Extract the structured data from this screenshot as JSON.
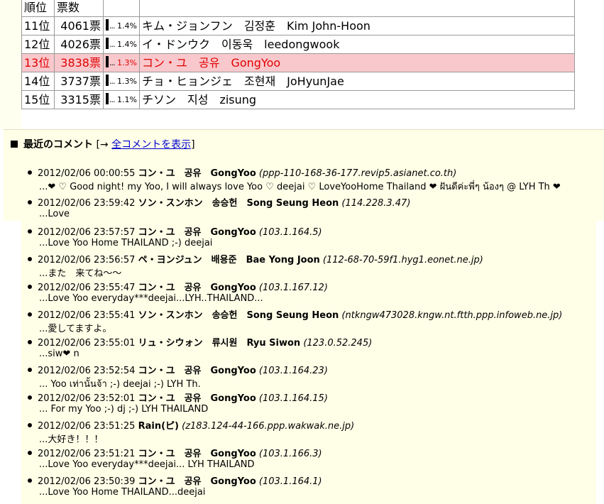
{
  "ranking": {
    "header": {
      "rank": "順位",
      "votes": "票数"
    },
    "rows": [
      {
        "rank": "11位",
        "votes": "4061票",
        "pct": "1.4%",
        "name": "キム・ジョンフン　김정훈　Kim John-Hoon",
        "highlight": false
      },
      {
        "rank": "12位",
        "votes": "4026票",
        "pct": "1.4%",
        "name": "イ・ドンウク　이동욱　leedongwook",
        "highlight": false
      },
      {
        "rank": "13位",
        "votes": "3838票",
        "pct": "1.3%",
        "name": "コン・ユ　공유　GongYoo",
        "highlight": true
      },
      {
        "rank": "14位",
        "votes": "3737票",
        "pct": "1.3%",
        "name": "チョ・ヒョンジェ　조현재　JoHyunJae",
        "highlight": false
      },
      {
        "rank": "15位",
        "votes": "3315票",
        "pct": "1.1%",
        "name": "チソン　지성　zisung",
        "highlight": false
      }
    ]
  },
  "comments": {
    "title": "最近のコメント",
    "link_prefix": " [→ ",
    "link_label": "全コメントを表示",
    "link_suffix": "]",
    "items": [
      {
        "time": "2012/02/06 00:00:55",
        "name": "コン・ユ　공유　GongYoo",
        "host": "(ppp-110-168-36-177.revip5.asianet.co.th)",
        "text": "...❤ ♡ Good night! my Yoo, I will always love Yoo ♡ deejai ♡ LoveYooHome Thailand ❤ ฝันดีค่ะพี่ๆ น้องๆ @ LYH Th ❤"
      },
      {
        "time": "2012/02/06 23:59:42",
        "name": "ソン・スンホン　송승헌　Song Seung Heon",
        "host": "(114.228.3.47)",
        "text": "...Love"
      },
      {
        "time": "2012/02/06 23:57:57",
        "name": "コン・ユ　공유　GongYoo",
        "host": "(103.1.164.5)",
        "text": "...Love Yoo Home THAILAND ;-) deejai"
      },
      {
        "time": "2012/02/06 23:56:57",
        "name": "ペ・ヨンジュン　배용준　Bae Yong Joon",
        "host": "(112-68-70-59f1.hyg1.eonet.ne.jp)",
        "text": "...また　来てね～～"
      },
      {
        "time": "2012/02/06 23:55:47",
        "name": "コン・ユ　공유　GongYoo",
        "host": "(103.1.167.12)",
        "text": "...Love Yoo everyday***deejai...LYH..THAILAND..."
      },
      {
        "time": "2012/02/06 23:55:41",
        "name": "ソン・スンホン　송승헌　Song Seung Heon",
        "host": "(ntkngw473028.kngw.nt.ftth.ppp.infoweb.ne.jp)",
        "text": "...愛してますよ。"
      },
      {
        "time": "2012/02/06 23:55:01",
        "name": "リュ・シウォン　류시원　Ryu Siwon",
        "host": "(123.0.52.245)",
        "text": "...siw❤ n"
      },
      {
        "time": "2012/02/06 23:52:54",
        "name": "コン・ユ　공유　GongYoo",
        "host": "(103.1.164.23)",
        "text": "... Yoo เท่านั้นจ้า ;-) deejai ;-) LYH Th."
      },
      {
        "time": "2012/02/06 23:52:01",
        "name": "コン・ユ　공유　GongYoo",
        "host": "(103.1.164.15)",
        "text": "... For my Yoo ;-) dj ;-) LYH THAILAND"
      },
      {
        "time": "2012/02/06 23:51:25",
        "name": "Rain(ピ)",
        "host": "(z183.124-44-166.ppp.wakwak.ne.jp)",
        "text": "...大好き！！！"
      },
      {
        "time": "2012/02/06 23:51:21",
        "name": "コン・ユ　공유　GongYoo",
        "host": "(103.1.166.3)",
        "text": "...Love Yoo everyday***deejai... LYH THAILAND"
      },
      {
        "time": "2012/02/06 23:50:39",
        "name": "コン・ユ　공유　GongYoo",
        "host": "(103.1.164.1)",
        "text": "...Love Yoo Home THAILAND...deejai"
      }
    ]
  }
}
